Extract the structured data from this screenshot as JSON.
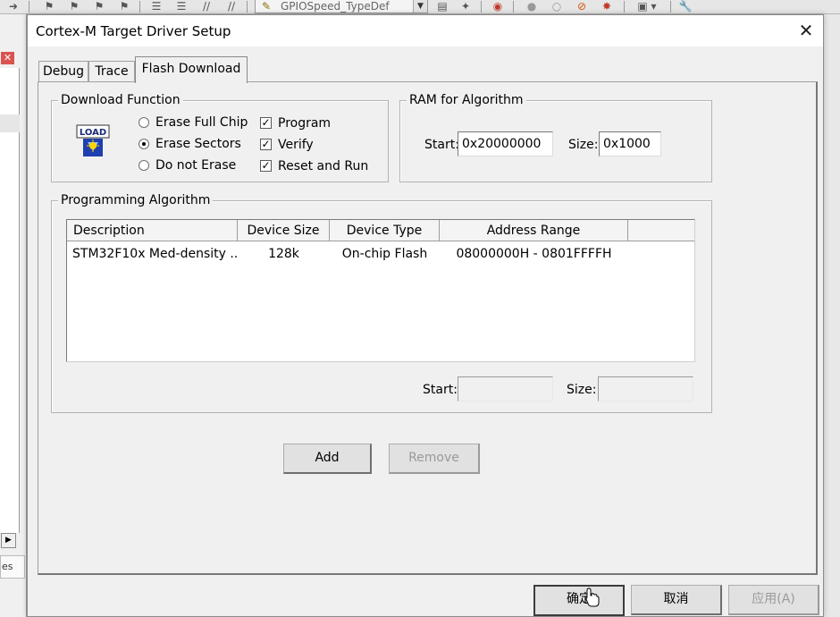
{
  "ide": {
    "toolbar_icons": [
      "arrow-right-icon",
      "bookmark-icon",
      "bookmark-prev-icon",
      "bookmark-next-icon",
      "bookmark-clear-icon",
      "indent-icon",
      "unindent-icon",
      "comment-icon",
      "uncomment-icon",
      "find-in-files-icon",
      "target-combo-icon",
      "zoom-icon",
      "breakpoint-icon",
      "breakpoint-disable-icon",
      "debug-icon",
      "debug-stop-icon",
      "window-icon",
      "settings-icon"
    ],
    "function_combo_text": "GPIOSpeed_TypeDef",
    "side_tab_fragment": "es"
  },
  "dialog": {
    "title": "Cortex-M Target Driver Setup",
    "close_glyph": "✕",
    "tabs": [
      {
        "label": "Debug",
        "active": false
      },
      {
        "label": "Trace",
        "active": false
      },
      {
        "label": "Flash Download",
        "active": true
      }
    ],
    "download_function": {
      "title": "Download Function",
      "icon_text": "LOAD",
      "erase_options": [
        {
          "label": "Erase Full Chip",
          "selected": false
        },
        {
          "label": "Erase Sectors",
          "selected": true
        },
        {
          "label": "Do not Erase",
          "selected": false
        }
      ],
      "checks": [
        {
          "label": "Program",
          "checked": true
        },
        {
          "label": "Verify",
          "checked": true
        },
        {
          "label": "Reset and Run",
          "checked": true
        }
      ]
    },
    "ram_for_algorithm": {
      "title": "RAM for Algorithm",
      "start_label": "Start:",
      "start_value": "0x20000000",
      "size_label": "Size:",
      "size_value": "0x1000"
    },
    "programming_algorithm": {
      "title": "Programming Algorithm",
      "columns": [
        "Description",
        "Device Size",
        "Device Type",
        "Address Range"
      ],
      "rows": [
        {
          "description": "STM32F10x Med-density ...",
          "device_size": "128k",
          "device_type": "On-chip Flash",
          "address_range": "08000000H - 0801FFFFH"
        }
      ],
      "start_label": "Start:",
      "start_value": "",
      "size_label": "Size:",
      "size_value": ""
    },
    "buttons": {
      "add": "Add",
      "remove": "Remove",
      "ok": "确定",
      "cancel": "取消",
      "apply": "应用(A)"
    }
  }
}
